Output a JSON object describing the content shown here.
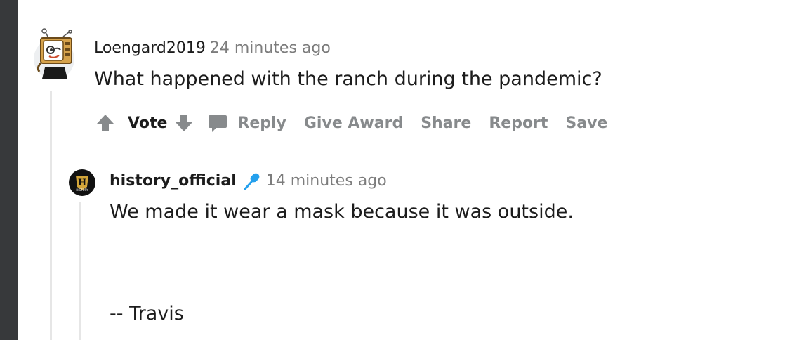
{
  "comment1": {
    "author": "Loengard2019",
    "timestamp": "24 minutes ago",
    "body": "What happened with the ranch during the pandemic?",
    "avatar_icon": "snoo-tv-avatar-icon"
  },
  "actions": {
    "vote": "Vote",
    "reply": "Reply",
    "give_award": "Give Award",
    "share": "Share",
    "report": "Report",
    "save": "Save"
  },
  "comment2": {
    "author": "history_official",
    "badge_icon": "microphone-icon",
    "timestamp": "14 minutes ago",
    "body_line1": "We made it wear a mask because it was outside.",
    "body_signature": "-- Travis",
    "avatar_logo_letter": "H",
    "avatar_logo_text": "HISTORY"
  },
  "colors": {
    "text": "#1c1c1c",
    "meta": "#7c7c7c",
    "action": "#878a8c",
    "mic": "#24a0ed",
    "thread": "#e6e6e6",
    "left_strip": "#37393b"
  }
}
